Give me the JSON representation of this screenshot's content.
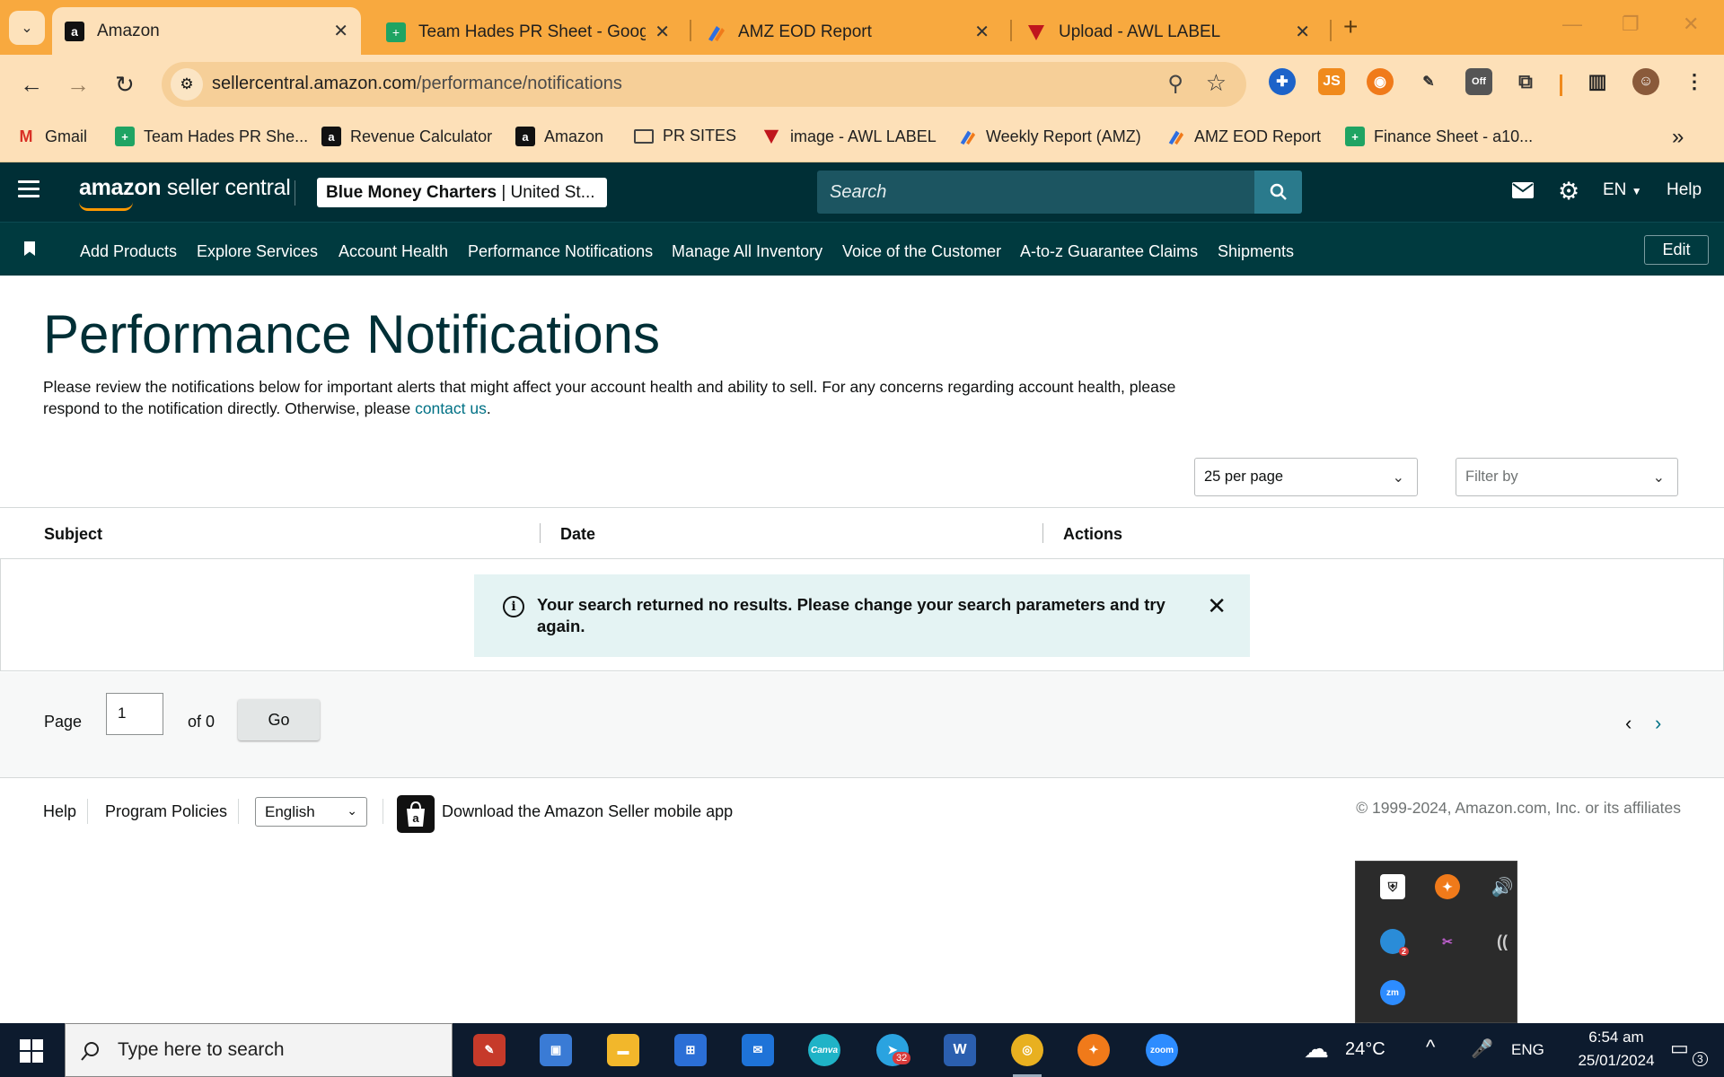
{
  "browser": {
    "tabs": [
      {
        "title": "Amazon",
        "icon": "amazon-icon"
      },
      {
        "title": "Team Hades PR Sheet - Google",
        "icon": "google-sheets-icon"
      },
      {
        "title": "AMZ EOD Report",
        "icon": "report-icon"
      },
      {
        "title": "Upload - AWL LABEL",
        "icon": "awl-icon"
      }
    ],
    "url_host": "sellercentral.amazon.com",
    "url_path": "/performance/notifications",
    "extensions": {
      "js_label": "JS",
      "off_badge": "Off"
    },
    "bookmarks": [
      {
        "label": "Gmail",
        "icon": "gmail-icon"
      },
      {
        "label": "Team Hades PR She...",
        "icon": "google-sheets-icon"
      },
      {
        "label": "Revenue Calculator",
        "icon": "amazon-icon"
      },
      {
        "label": "Amazon",
        "icon": "amazon-icon"
      },
      {
        "label": "PR SITES",
        "icon": "folder-icon"
      },
      {
        "label": "image - AWL LABEL",
        "icon": "awl-icon"
      },
      {
        "label": "Weekly Report (AMZ)",
        "icon": "report-icon"
      },
      {
        "label": "AMZ EOD Report",
        "icon": "report-icon"
      },
      {
        "label": "Finance Sheet - a10...",
        "icon": "google-sheets-icon"
      }
    ]
  },
  "header": {
    "logo_bold": "amazon",
    "logo_rest": " seller central",
    "store_name": "Blue Money Charters",
    "store_region": " | United St...",
    "search_placeholder": "Search",
    "language": "EN",
    "help": "Help"
  },
  "nav": {
    "items": [
      "Add Products",
      "Explore Services",
      "Account Health",
      "Performance Notifications",
      "Manage All Inventory",
      "Voice of the Customer",
      "A-to-z Guarantee Claims",
      "Shipments"
    ],
    "edit": "Edit"
  },
  "main": {
    "title": "Performance Notifications",
    "intro_text": "Please review the notifications below for important alerts that might affect your account health and ability to sell. For any concerns regarding account health, please respond to the notification directly. Otherwise, please ",
    "intro_link": "contact us",
    "intro_end": ".",
    "per_page": "25 per page",
    "filter_placeholder": "Filter by",
    "columns": [
      "Subject",
      "Date",
      "Actions"
    ],
    "alert_message": "Your search returned no results. Please change your search parameters and try again.",
    "pagination": {
      "page_label": "Page",
      "page_value": "1",
      "of_label": "of 0",
      "go": "Go"
    }
  },
  "footer": {
    "help": "Help",
    "policies": "Program Policies",
    "language": "English",
    "app_text": "Download the Amazon Seller mobile app",
    "copyright": "© 1999-2024, Amazon.com, Inc. or its affiliates"
  },
  "tray": {
    "badge": "2"
  },
  "taskbar": {
    "search_placeholder": "Type here to search",
    "telegram_badge": "32",
    "canva_label": "Canva",
    "zoom_label": "zoom",
    "weather": "24°C",
    "lang": "ENG",
    "time": "6:54 am",
    "date": "25/01/2024",
    "notifications": "3"
  },
  "colors": {
    "chrome_accent": "#f8a93f",
    "sc_header": "#002f36",
    "sc_nav": "#003a3f",
    "link": "#007185",
    "alert_bg": "#e4f3f3"
  }
}
